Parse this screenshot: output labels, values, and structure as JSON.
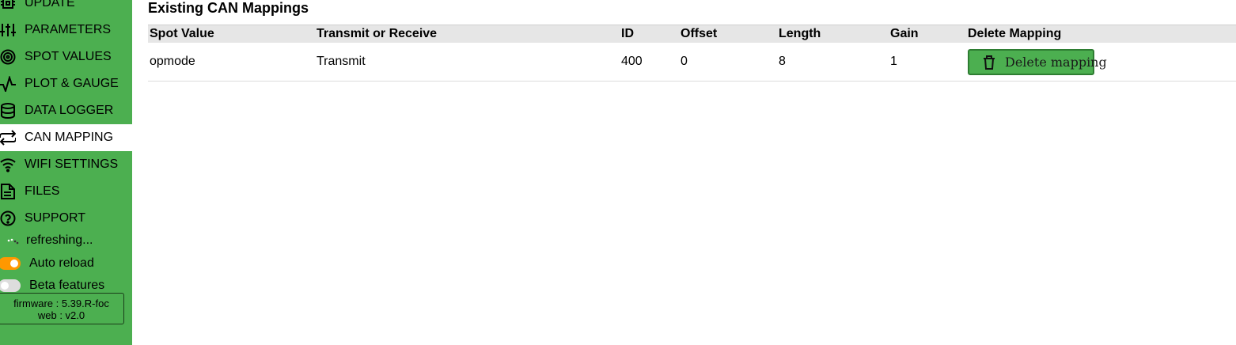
{
  "sidebar": {
    "items": [
      {
        "label": "UPDATE",
        "icon": "chip-icon"
      },
      {
        "label": "PARAMETERS",
        "icon": "sliders-icon"
      },
      {
        "label": "SPOT VALUES",
        "icon": "target-icon"
      },
      {
        "label": "PLOT & GAUGE",
        "icon": "activity-icon"
      },
      {
        "label": "DATA LOGGER",
        "icon": "database-icon"
      },
      {
        "label": "CAN MAPPING",
        "icon": "repeat-icon"
      },
      {
        "label": "WIFI SETTINGS",
        "icon": "wifi-icon"
      },
      {
        "label": "FILES",
        "icon": "file-icon"
      },
      {
        "label": "SUPPORT",
        "icon": "help-circle-icon"
      }
    ],
    "active": "CAN MAPPING",
    "refresh_text": "refreshing...",
    "auto_reload": {
      "label": "Auto reload",
      "on": true
    },
    "beta_features": {
      "label": "Beta features",
      "on": false
    },
    "firmware": "firmware : 5.39.R-foc",
    "web": "web : v2.0"
  },
  "main": {
    "title": "Existing CAN Mappings",
    "columns": [
      "Spot Value",
      "Transmit or Receive",
      "ID",
      "Offset",
      "Length",
      "Gain",
      "Delete Mapping"
    ],
    "rows": [
      {
        "spot_value": "opmode",
        "direction": "Transmit",
        "id": "400",
        "offset": "0",
        "length": "8",
        "gain": "1",
        "delete_label": "Delete mapping"
      }
    ]
  },
  "colors": {
    "sidebar": "#4caf50",
    "toggle_on": "#ff9800",
    "toggle_off": "#dddddd",
    "header_bg": "#e6e6e6"
  }
}
